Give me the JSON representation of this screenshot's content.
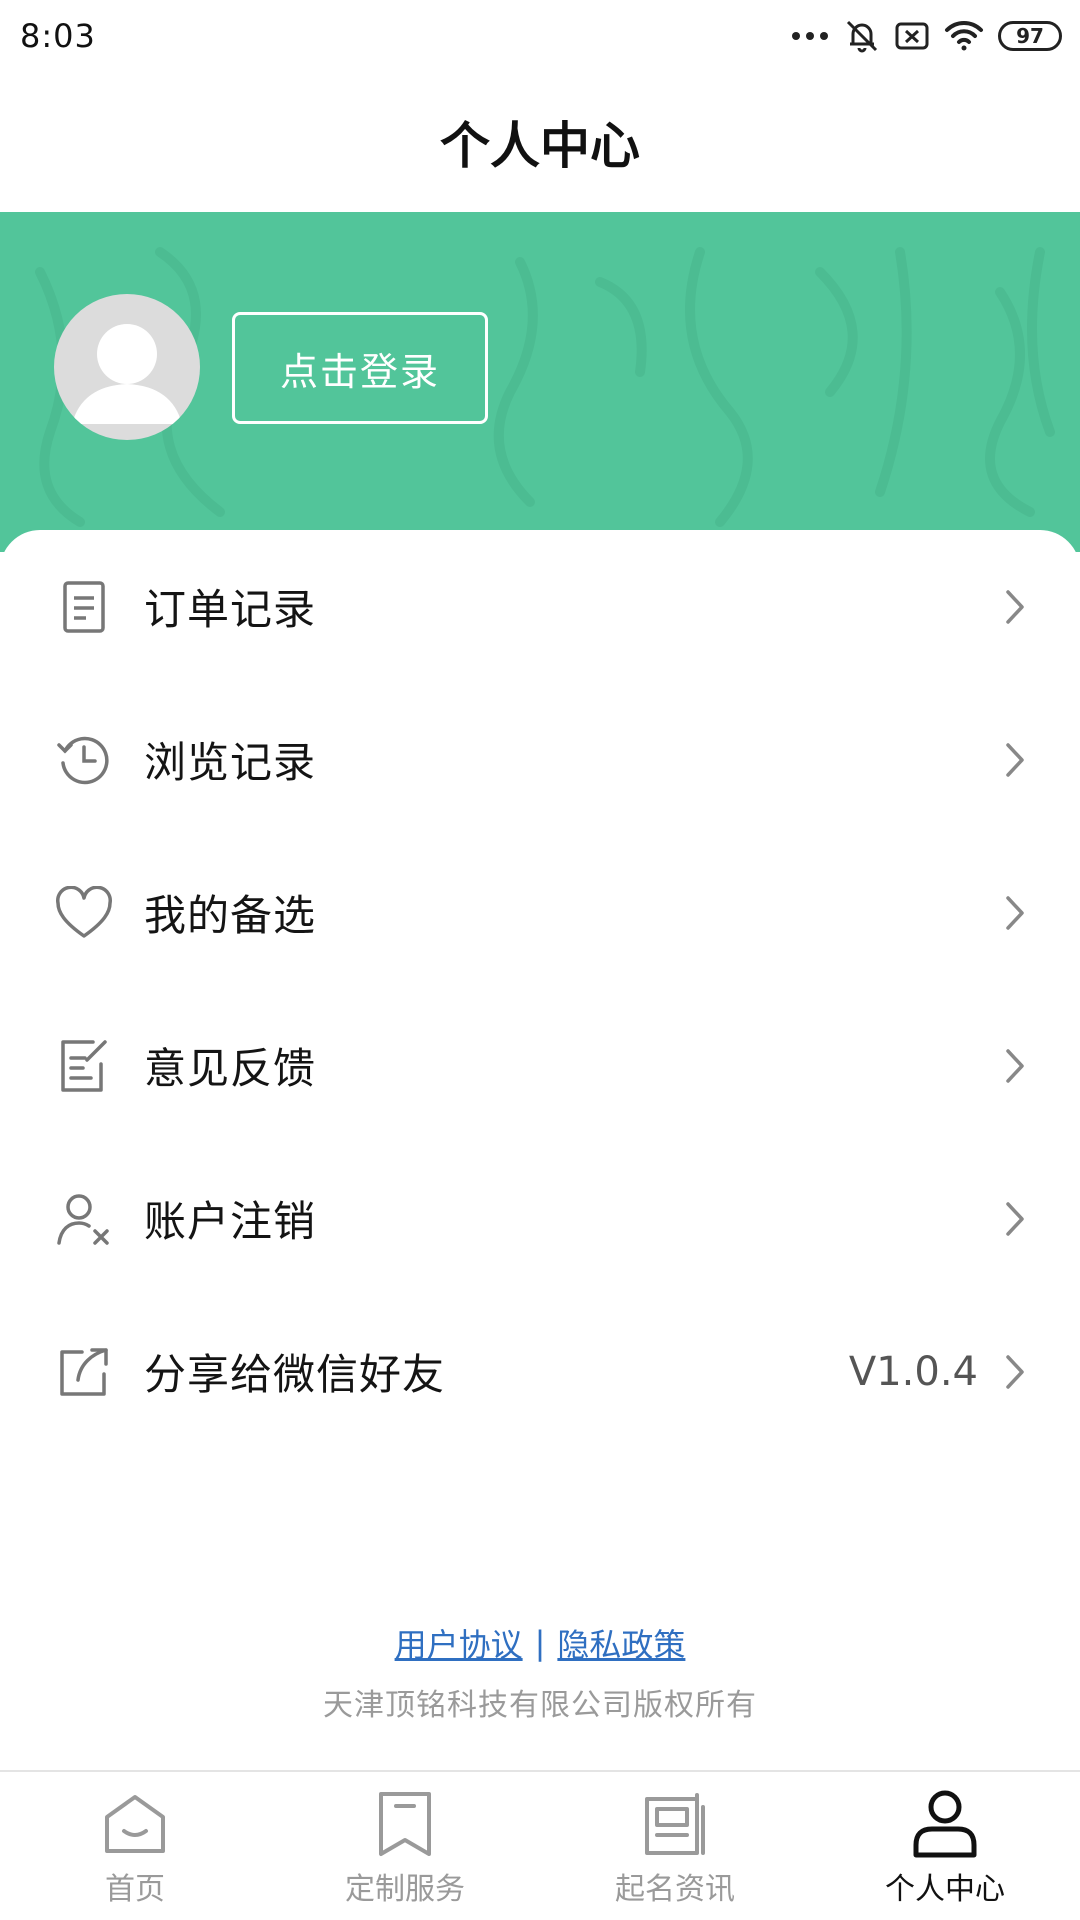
{
  "status_bar": {
    "time": "8:03",
    "battery": "97"
  },
  "header": {
    "title": "个人中心"
  },
  "profile": {
    "login_label": "点击登录",
    "accent_color": "#52c59a"
  },
  "menu": {
    "items": [
      {
        "label": "订单记录",
        "icon": "order-list-icon",
        "value": ""
      },
      {
        "label": "浏览记录",
        "icon": "history-icon",
        "value": ""
      },
      {
        "label": "我的备选",
        "icon": "heart-icon",
        "value": ""
      },
      {
        "label": "意见反馈",
        "icon": "feedback-edit-icon",
        "value": ""
      },
      {
        "label": "账户注销",
        "icon": "user-remove-icon",
        "value": ""
      },
      {
        "label": "分享给微信好友",
        "icon": "share-icon",
        "value": "V1.0.4"
      }
    ]
  },
  "footer": {
    "user_agreement": "用户协议",
    "separator": "|",
    "privacy_policy": "隐私政策",
    "copyright": "天津顶铭科技有限公司版权所有",
    "link_color": "#2f6fc1"
  },
  "tab_bar": {
    "tabs": [
      {
        "label": "首页",
        "icon": "home-icon",
        "active": false
      },
      {
        "label": "定制服务",
        "icon": "bookmark-icon",
        "active": false
      },
      {
        "label": "起名资讯",
        "icon": "news-icon",
        "active": false
      },
      {
        "label": "个人中心",
        "icon": "person-icon",
        "active": true
      }
    ]
  }
}
